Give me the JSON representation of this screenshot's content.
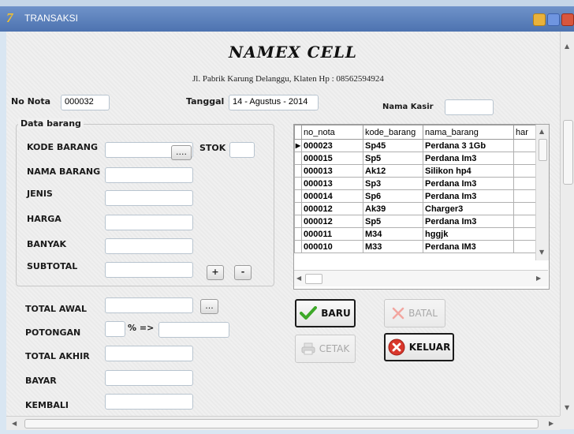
{
  "window": {
    "title": "TRANSAKSI"
  },
  "header": {
    "store_name": "NAMEX CELL",
    "address": "Jl. Pabrik Karung Delanggu, Klaten Hp : 08562594924"
  },
  "top": {
    "no_nota_label": "No Nota",
    "no_nota_value": "000032",
    "tanggal_label": "Tanggal",
    "tanggal_value": "14 - Agustus - 2014",
    "kasir_label": "Nama Kasir",
    "kasir_value": ""
  },
  "data_barang": {
    "group_title": "Data barang",
    "kode_label": "KODE BARANG",
    "kode_value": "",
    "browse_label": "....",
    "stok_label": "STOK",
    "stok_value": "",
    "nama_label": "NAMA BARANG",
    "nama_value": "",
    "jenis_label": "JENIS",
    "jenis_value": "",
    "harga_label": "HARGA",
    "harga_value": "",
    "banyak_label": "BANYAK",
    "banyak_value": "",
    "subtotal_label": "SUBTOTAL",
    "subtotal_value": "",
    "plus_label": "+",
    "minus_label": "-"
  },
  "totals": {
    "total_awal_label": "TOTAL AWAL",
    "total_awal_value": "",
    "total_awal_btn": "...",
    "potongan_label": "POTONGAN",
    "potongan_pct_value": "",
    "potongan_arrow": "% =>",
    "potongan_value": "",
    "total_akhir_label": "TOTAL AKHIR",
    "total_akhir_value": "",
    "bayar_label": "BAYAR",
    "bayar_value": "",
    "kembali_label": "KEMBALI",
    "kembali_value": ""
  },
  "grid": {
    "columns": [
      "no_nota",
      "kode_barang",
      "nama_barang",
      "har"
    ],
    "rows": [
      [
        "000023",
        "Sp45",
        "Perdana 3 1Gb",
        ""
      ],
      [
        "000015",
        "Sp5",
        "Perdana Im3",
        ""
      ],
      [
        "000013",
        "Ak12",
        "Silikon hp4",
        ""
      ],
      [
        "000013",
        "Sp3",
        "Perdana Im3",
        ""
      ],
      [
        "000014",
        "Sp6",
        "Perdana Im3",
        ""
      ],
      [
        "000012",
        "Ak39",
        "Charger3",
        ""
      ],
      [
        "000012",
        "Sp5",
        "Perdana Im3",
        ""
      ],
      [
        "000011",
        "M34",
        "hggjk",
        ""
      ],
      [
        "000010",
        "M33",
        "Perdana IM3",
        ""
      ]
    ]
  },
  "buttons": {
    "baru": "BARU",
    "batal": "BATAL",
    "cetak": "CETAK",
    "keluar": "KELUAR"
  },
  "icons": {
    "app": "app-icon",
    "minimize": "minimize-icon",
    "maximize": "maximize-icon",
    "close": "close-icon",
    "baru": "checkmark-icon",
    "batal": "x-icon",
    "cetak": "printer-icon",
    "keluar": "close-circle-icon",
    "row_indicator": "row-pointer-icon"
  },
  "colors": {
    "titlebar": "#5a80bd",
    "keluar_icon": "#d9362b",
    "baru_icon": "#3da828"
  }
}
